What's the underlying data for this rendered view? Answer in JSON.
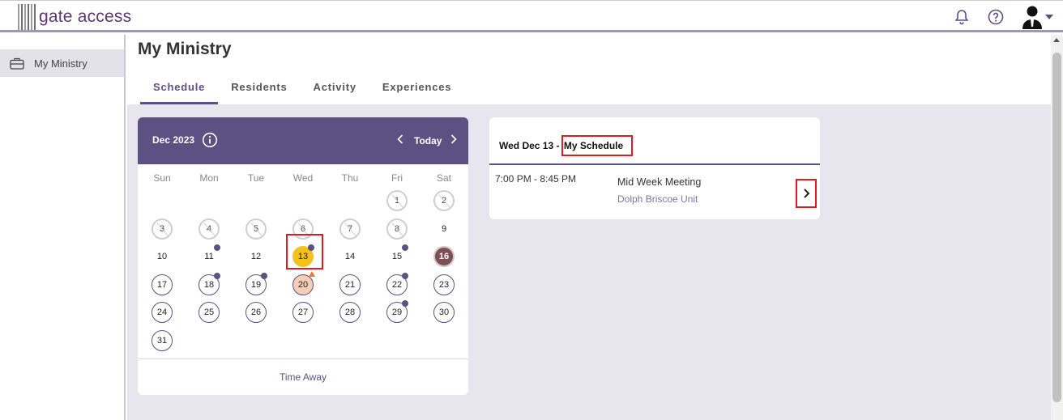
{
  "app": {
    "logo_text": "gate access"
  },
  "sidebar": {
    "items": [
      {
        "label": "My Ministry",
        "icon": "briefcase-icon"
      }
    ]
  },
  "page": {
    "title": "My Ministry",
    "tabs": [
      {
        "label": "Schedule",
        "active": true
      },
      {
        "label": "Residents",
        "active": false
      },
      {
        "label": "Activity",
        "active": false
      },
      {
        "label": "Experiences",
        "active": false
      }
    ]
  },
  "calendar": {
    "month_label": "Dec 2023",
    "today_label": "Today",
    "weekdays": [
      "Sun",
      "Mon",
      "Tue",
      "Wed",
      "Thu",
      "Fri",
      "Sat"
    ],
    "days": [
      {
        "n": "1",
        "state": "past",
        "row": 0,
        "col": 5
      },
      {
        "n": "2",
        "state": "past",
        "row": 0,
        "col": 6
      },
      {
        "n": "3",
        "state": "past",
        "row": 1,
        "col": 0
      },
      {
        "n": "4",
        "state": "past",
        "row": 1,
        "col": 1
      },
      {
        "n": "5",
        "state": "past",
        "row": 1,
        "col": 2
      },
      {
        "n": "6",
        "state": "past",
        "row": 1,
        "col": 3
      },
      {
        "n": "7",
        "state": "past",
        "row": 1,
        "col": 4
      },
      {
        "n": "8",
        "state": "past",
        "row": 1,
        "col": 5
      },
      {
        "n": "9",
        "state": "plain",
        "row": 1,
        "col": 6
      },
      {
        "n": "10",
        "state": "plain",
        "row": 2,
        "col": 0
      },
      {
        "n": "11",
        "state": "plain",
        "row": 2,
        "col": 1,
        "dot": true
      },
      {
        "n": "12",
        "state": "plain",
        "row": 2,
        "col": 2
      },
      {
        "n": "13",
        "state": "selected",
        "row": 2,
        "col": 3,
        "dot": true
      },
      {
        "n": "14",
        "state": "plain",
        "row": 2,
        "col": 4
      },
      {
        "n": "15",
        "state": "plain",
        "row": 2,
        "col": 5,
        "dot": true
      },
      {
        "n": "16",
        "state": "off",
        "row": 2,
        "col": 6
      },
      {
        "n": "17",
        "state": "open",
        "row": 3,
        "col": 0
      },
      {
        "n": "18",
        "state": "open",
        "row": 3,
        "col": 1,
        "dot": true
      },
      {
        "n": "19",
        "state": "open",
        "row": 3,
        "col": 2,
        "dot": true
      },
      {
        "n": "20",
        "state": "holiday",
        "row": 3,
        "col": 3,
        "flag": true
      },
      {
        "n": "21",
        "state": "open",
        "row": 3,
        "col": 4
      },
      {
        "n": "22",
        "state": "open",
        "row": 3,
        "col": 5,
        "dot": true
      },
      {
        "n": "23",
        "state": "open",
        "row": 3,
        "col": 6
      },
      {
        "n": "24",
        "state": "open",
        "row": 4,
        "col": 0
      },
      {
        "n": "25",
        "state": "open",
        "row": 4,
        "col": 1
      },
      {
        "n": "26",
        "state": "open",
        "row": 4,
        "col": 2
      },
      {
        "n": "27",
        "state": "open",
        "row": 4,
        "col": 3
      },
      {
        "n": "28",
        "state": "open",
        "row": 4,
        "col": 4
      },
      {
        "n": "29",
        "state": "open",
        "row": 4,
        "col": 5,
        "dot": true
      },
      {
        "n": "30",
        "state": "open",
        "row": 4,
        "col": 6
      },
      {
        "n": "31",
        "state": "open",
        "row": 5,
        "col": 0
      }
    ],
    "footer_label": "Time Away"
  },
  "schedule": {
    "date_label": "Wed Dec 13 -",
    "title_label": "My Schedule",
    "items": [
      {
        "time": "7:00 PM - 8:45 PM",
        "name": "Mid Week Meeting",
        "location": "Dolph Briscoe Unit"
      }
    ]
  },
  "colors": {
    "brand": "#5b5182",
    "highlight": "#e01b24",
    "selected_day": "#f4c21c"
  }
}
